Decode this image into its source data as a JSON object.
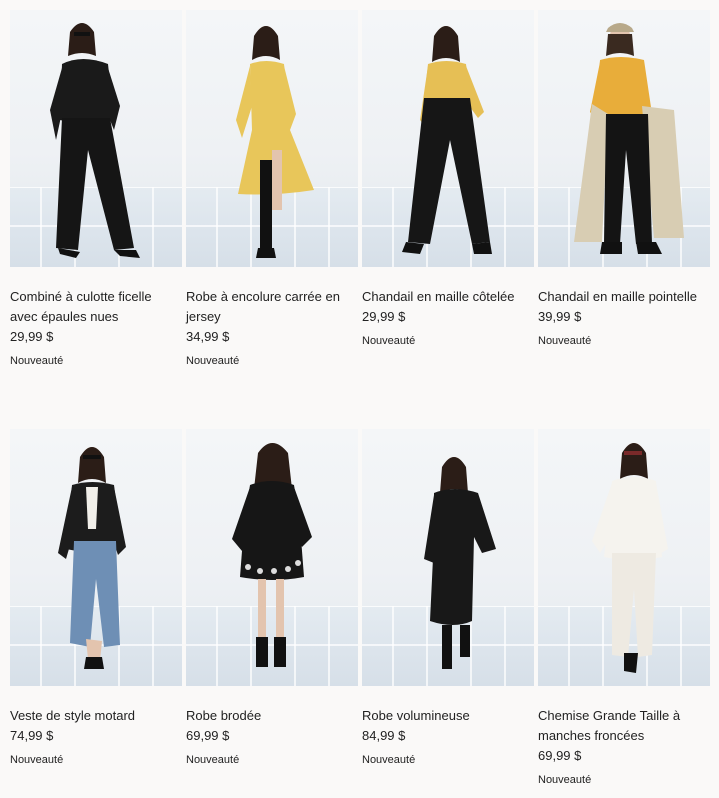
{
  "products": [
    {
      "name": "Combiné à culotte ficelle avec épaules nues",
      "price": "29,99 $",
      "badge": "Nouveauté",
      "image_icon": "model-black-jumpsuit-image"
    },
    {
      "name": "Robe à encolure carrée en jersey",
      "price": "34,99 $",
      "badge": "Nouveauté",
      "image_icon": "model-yellow-dress-image"
    },
    {
      "name": "Chandail en maille côtelée",
      "price": "29,99 $",
      "badge": "Nouveauté",
      "image_icon": "model-yellow-top-image"
    },
    {
      "name": "Chandail en maille pointelle",
      "price": "39,99 $",
      "badge": "Nouveauté",
      "image_icon": "model-yellow-sweater-trench-image"
    },
    {
      "name": "Veste de style motard",
      "price": "74,99 $",
      "badge": "Nouveauté",
      "image_icon": "model-biker-jacket-image"
    },
    {
      "name": "Robe brodée",
      "price": "69,99 $",
      "badge": "Nouveauté",
      "image_icon": "model-embroidered-dress-image"
    },
    {
      "name": "Robe volumineuse",
      "price": "84,99 $",
      "badge": "Nouveauté",
      "image_icon": "model-voluminous-dress-image"
    },
    {
      "name": "Chemise Grande Taille à manches froncées",
      "price": "69,99 $",
      "badge": "Nouveauté",
      "image_icon": "model-white-shirt-image"
    }
  ],
  "colors": {
    "background": "#faf9f8",
    "text": "#222222"
  }
}
